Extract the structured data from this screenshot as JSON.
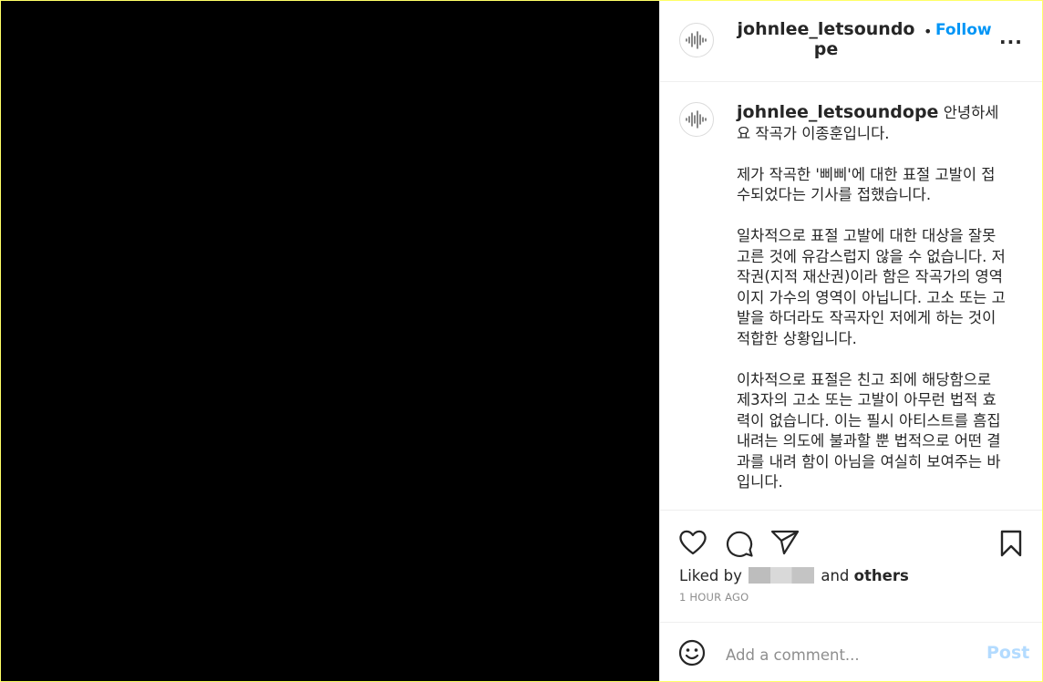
{
  "header": {
    "username": "johnlee_letsoundope",
    "separator": "•",
    "follow_label": "Follow",
    "more_label": "..."
  },
  "caption": {
    "username": "johnlee_letsoundope",
    "paragraphs": [
      "안녕하세요 작곡가 이종훈입니다.",
      "제가 작곡한 '삐삐'에 대한 표절 고발이 접수되었다는 기사를 접했습니다.",
      "일차적으로 표절 고발에 대한 대상을 잘못 고른 것에 유감스럽지 않을 수 없습니다. 저작권(지적 재산권)이라 함은 작곡가의 영역이지 가수의 영역이 아닙니다. 고소 또는 고발을 하더라도 작곡자인 저에게 하는 것이 적합한 상황입니다.",
      "이차적으로 표절은 친고 죄에 해당함으로 제3자의 고소 또는 고발이 아무런 법적 효력이 없습니다. 이는 필시 아티스트를 흠집 내려는 의도에 불과할 뿐 법적으로 어떤 결과를 내려 함이 아님을 여실히 보여주는 바입니다."
    ]
  },
  "actions": {
    "like_icon": "heart-icon",
    "comment_icon": "speech-bubble-icon",
    "share_icon": "paper-plane-icon",
    "save_icon": "bookmark-icon"
  },
  "likes": {
    "prefix": "Liked by",
    "connector": "and",
    "others": "others"
  },
  "timestamp": "1 HOUR AGO",
  "comment": {
    "placeholder": "Add a comment...",
    "post_label": "Post",
    "emoji_icon": "smiley-icon"
  },
  "colors": {
    "accent": "#0095f6",
    "post_disabled": "#b3dbff",
    "media_background": "#000000",
    "outer_border": "#ffff66"
  }
}
